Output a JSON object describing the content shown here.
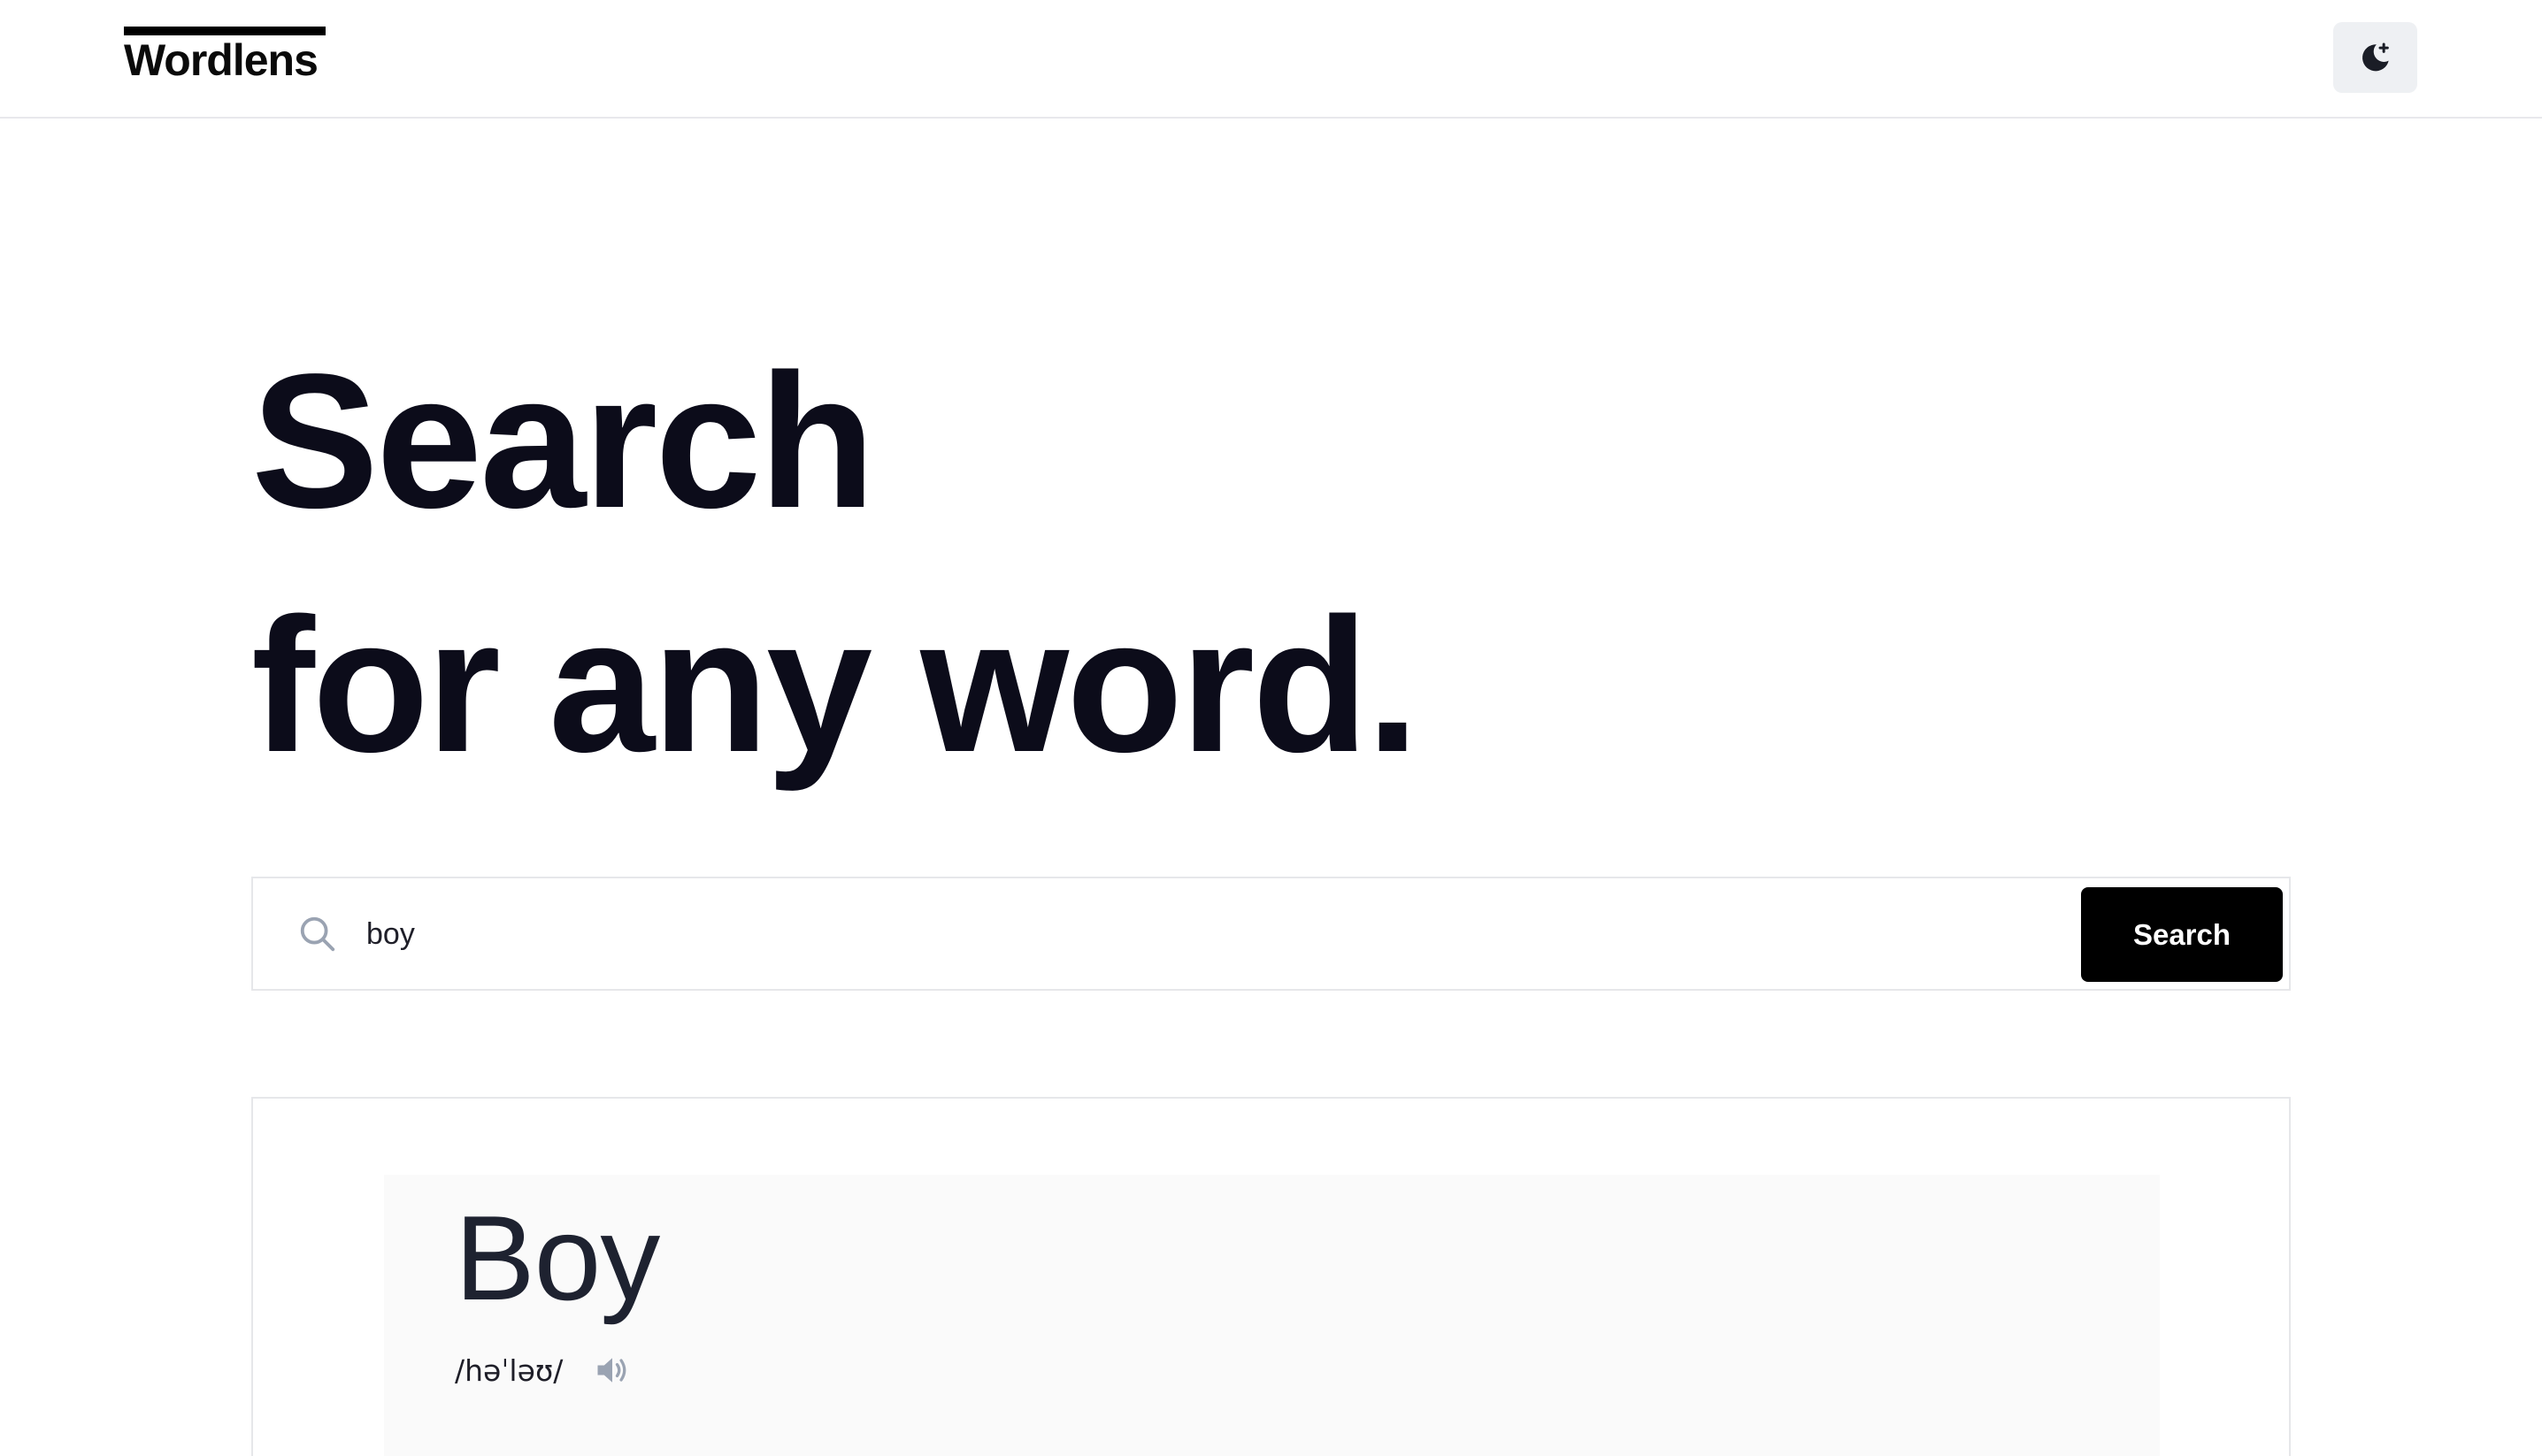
{
  "header": {
    "logo_text": "Wordlens",
    "theme_toggle_icon": "moon-sparkle-icon"
  },
  "hero": {
    "line1": "Search",
    "line2": "for any word."
  },
  "search": {
    "value": "boy",
    "button_label": "Search",
    "icon": "search-icon"
  },
  "result": {
    "word": "Boy",
    "phonetic": "/həˈləʊ/",
    "audio_icon": "speaker-icon"
  },
  "colors": {
    "button_bg": "#000000",
    "toggle_bg": "#eef0f3",
    "text_dark": "#0c0c1a",
    "panel_bg": "#fafafa",
    "icon_gray": "#9aa3b2"
  }
}
